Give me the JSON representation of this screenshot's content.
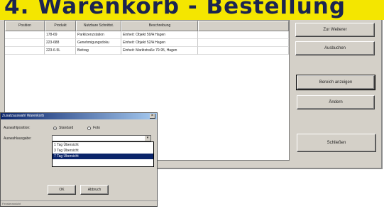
{
  "banner": {
    "title": "4. Warenkorb - Bestellung"
  },
  "table": {
    "columns": [
      "Position",
      "Produkt",
      "Nutzbare Schnittst.",
      "Beschreibung"
    ],
    "rows": [
      [
        "",
        "178-69",
        "Parklizenzstation",
        "Einheit: Objekt 59/A Hagen"
      ],
      [
        "",
        "223-688",
        "Genehmigungsdoku",
        "Einheit: Objekt 52/A Hagen"
      ],
      [
        "",
        "223-6-5L",
        "Beitrag",
        "Einheit: Marktstraße 79-95, Hagen"
      ]
    ]
  },
  "buttons": {
    "forward": "Zur Weiterer",
    "delete": "Ausbuchen",
    "show_area": "Bereich anzeigen",
    "edit": "Ändern",
    "close": "Schließen"
  },
  "dialog": {
    "title": "Zusatzauswahl Warenkorb",
    "label_type": "Auswahlposition:",
    "label_select": "Auswahlausgabe:",
    "radio_1": "Standard",
    "radio_2": "Foto",
    "combo_value": "",
    "options": [
      "1 Tag Übersicht",
      "3 Tag Übersicht",
      "7 Tag Übersicht"
    ],
    "ok": "OK",
    "cancel": "Abbruch",
    "status": "Fensteransicht"
  }
}
